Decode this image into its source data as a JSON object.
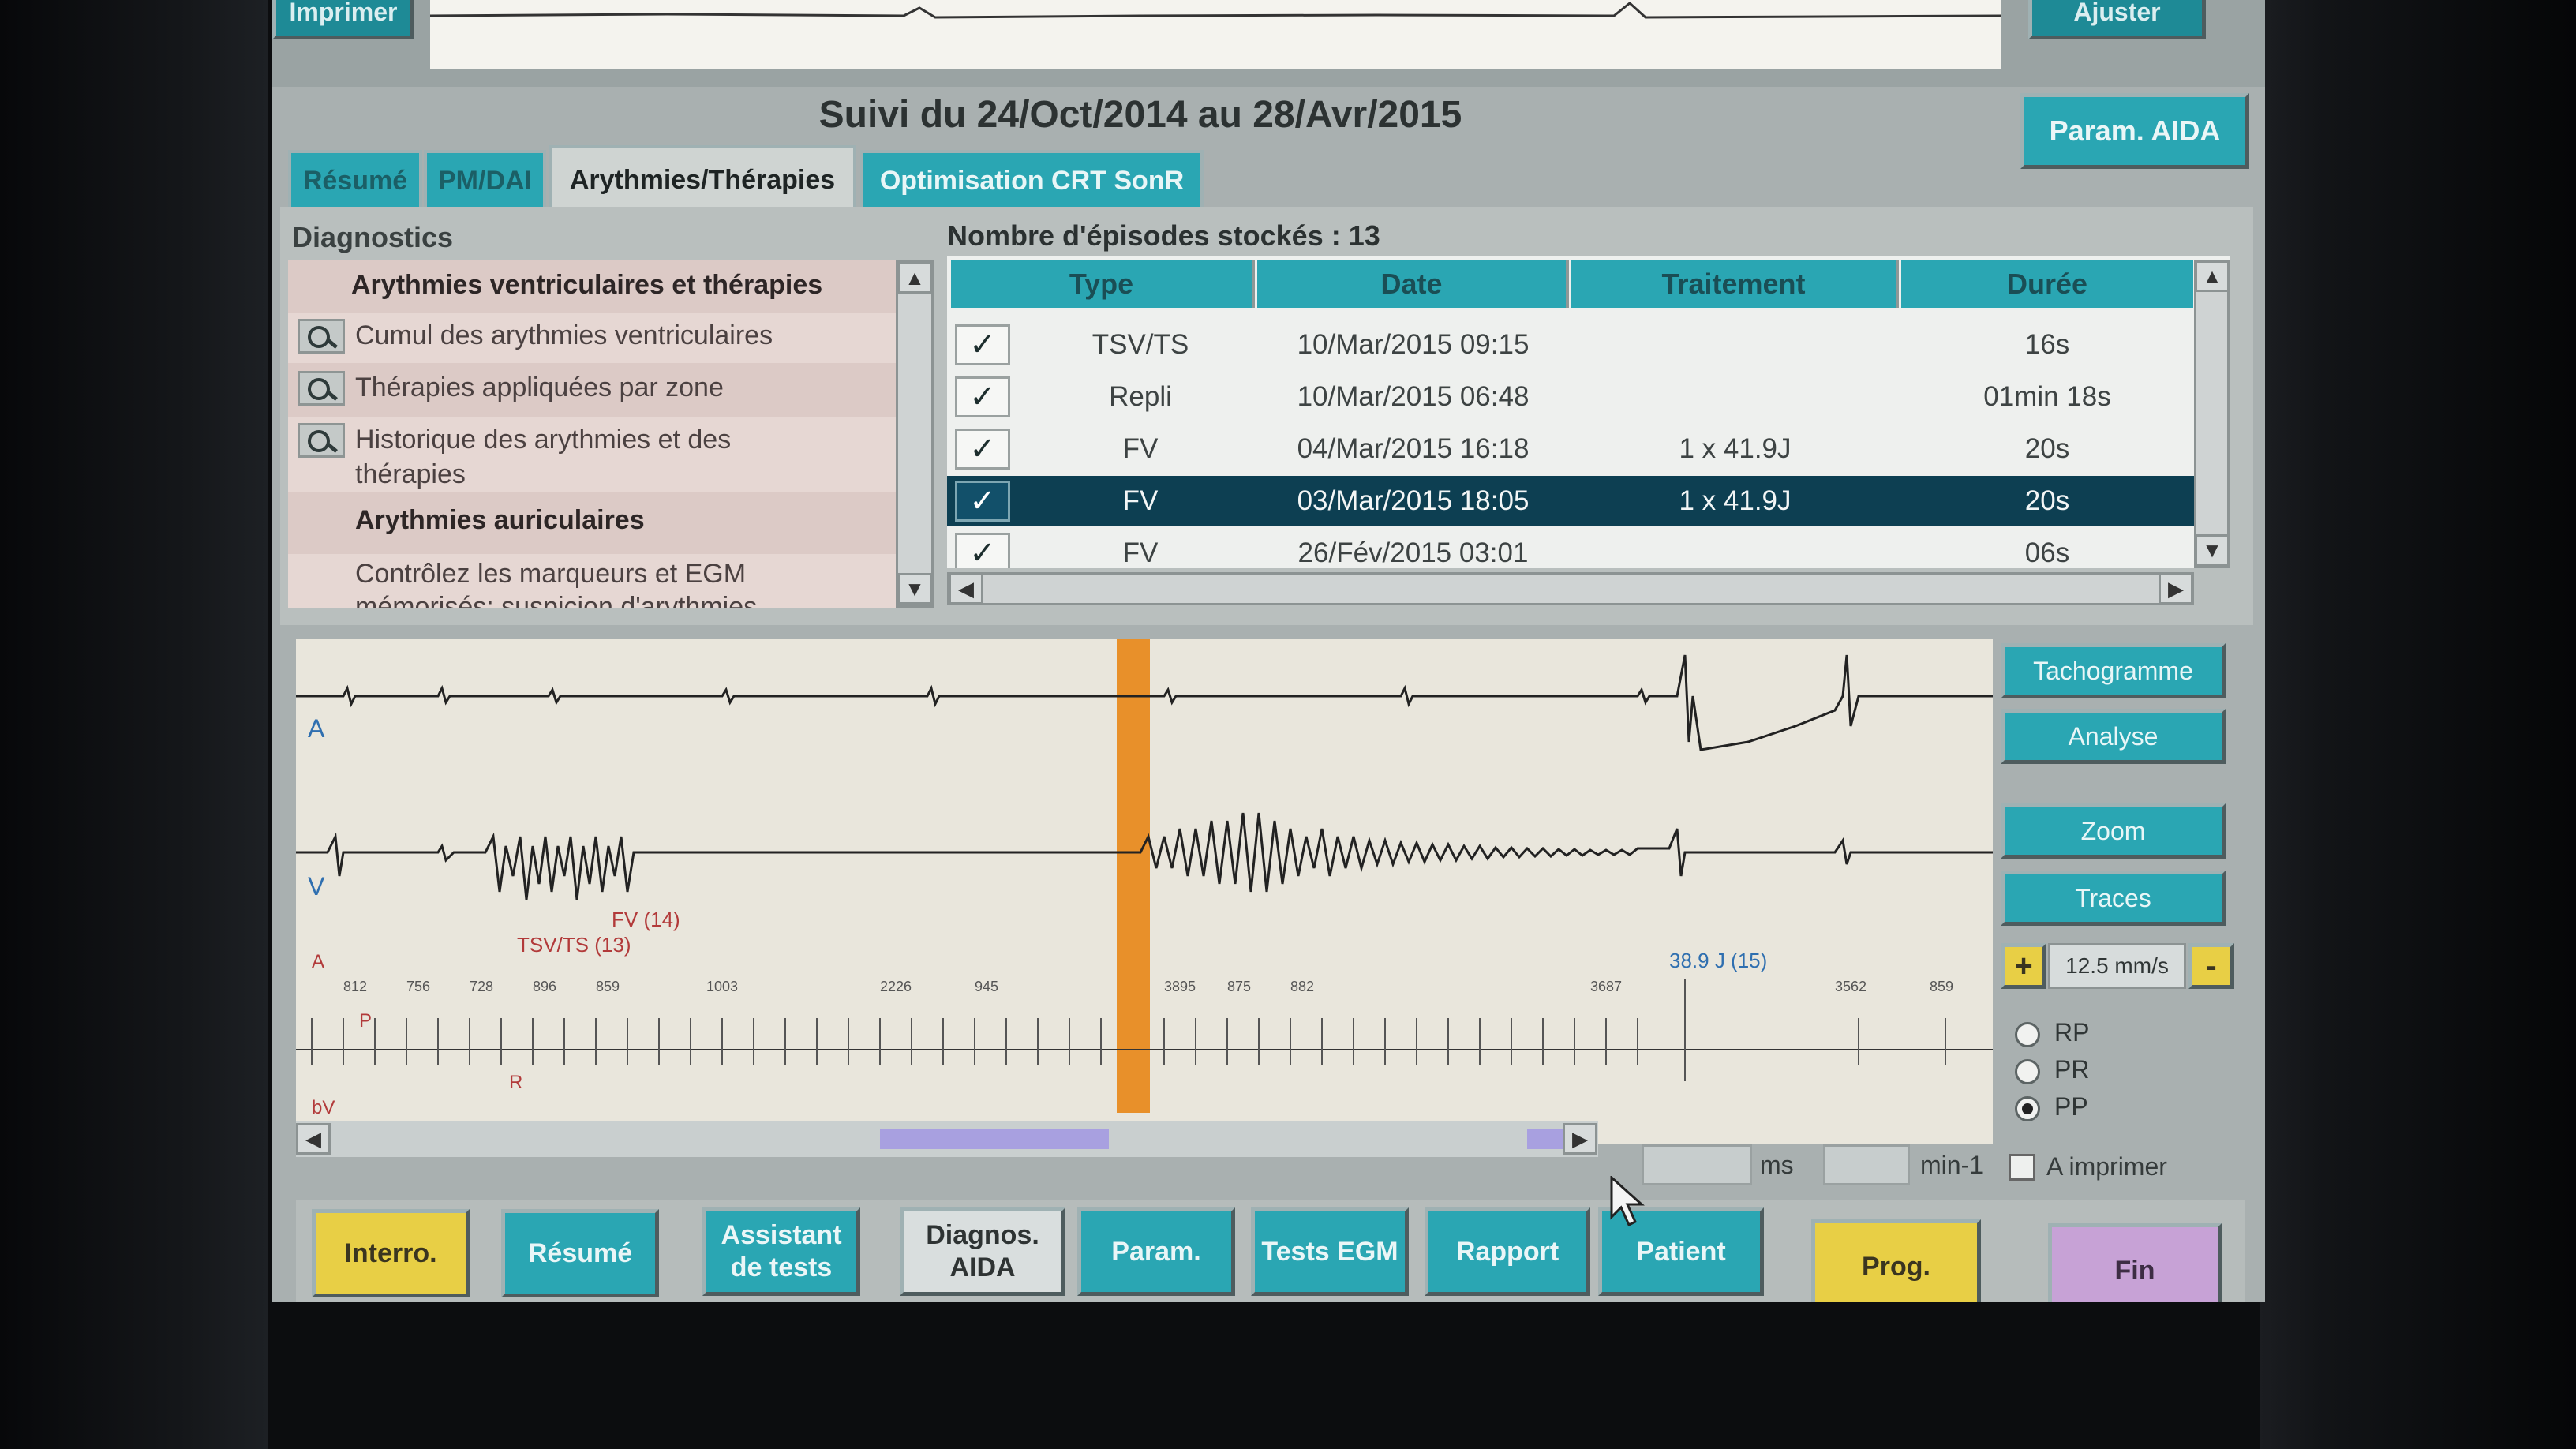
{
  "top": {
    "print_button": "Imprimer",
    "adjust_button": "Ajuster"
  },
  "title": "Suivi du 24/Oct/2014 au 28/Avr/2015",
  "param_aida_button": "Param. AIDA",
  "tabs": [
    {
      "label": "Résumé",
      "active": false
    },
    {
      "label": "PM/DAI",
      "active": false
    },
    {
      "label": "Arythmies/Thérapies",
      "active": true
    },
    {
      "label": "Optimisation CRT SonR",
      "active": false
    }
  ],
  "diagnostics": {
    "label": "Diagnostics",
    "items": [
      {
        "text": "Arythmies ventriculaires et thérapies",
        "header": true
      },
      {
        "text": "Cumul des arythmies ventriculaires",
        "icon": "magnifier-icon"
      },
      {
        "text": "Thérapies appliquées par zone",
        "icon": "magnifier-icon"
      },
      {
        "text": "Historique des arythmies et des",
        "text2": "thérapies",
        "icon": "magnifier-icon"
      },
      {
        "text": "Arythmies auriculaires",
        "header": true
      },
      {
        "text": "Contrôlez les marqueurs et EGM",
        "text2": "mémorisés: suspicion d'arythmies"
      }
    ]
  },
  "episodes": {
    "label": "Nombre d'épisodes stockés : 13",
    "columns": [
      "Type",
      "Date",
      "Traitement",
      "Durée"
    ],
    "rows": [
      {
        "type": "TSV/TS",
        "date": "10/Mar/2015 09:15",
        "treatment": "",
        "duration": "16s",
        "selected": false
      },
      {
        "type": "Repli",
        "date": "10/Mar/2015 06:48",
        "treatment": "",
        "duration": "01min 18s",
        "selected": false
      },
      {
        "type": "FV",
        "date": "04/Mar/2015 16:18",
        "treatment": "1 x 41.9J",
        "duration": "20s",
        "selected": false
      },
      {
        "type": "FV",
        "date": "03/Mar/2015 18:05",
        "treatment": "1 x 41.9J",
        "duration": "20s",
        "selected": true
      },
      {
        "type": "FV",
        "date": "26/Fév/2015 03:01",
        "treatment": "",
        "duration": "06s",
        "selected": false
      }
    ]
  },
  "ecg": {
    "channel_a": "A",
    "channel_v": "V",
    "marker_fv": "FV (14)",
    "marker_tsv": "TSV/TS (13)",
    "shock_label": "38.9 J (15)",
    "r_label": "R",
    "a_label": "A",
    "p_label": "P",
    "bv_label": "bV",
    "interval_values": [
      "812",
      "756",
      "728",
      "896",
      "859",
      "1003",
      "2226",
      "945",
      "3895",
      "875",
      "882",
      "3687",
      "3562",
      "859"
    ]
  },
  "side_buttons": [
    "Tachogramme",
    "Analyse",
    "Zoom",
    "Traces"
  ],
  "speed": {
    "plus": "+",
    "value": "12.5 mm/s",
    "minus": "-"
  },
  "radio": [
    {
      "label": "RP",
      "checked": false
    },
    {
      "label": "PR",
      "checked": false
    },
    {
      "label": "PP",
      "checked": true
    }
  ],
  "units": {
    "ms": "ms",
    "min": "min-1"
  },
  "print_checkbox": "A imprimer",
  "bottom_buttons": [
    {
      "label": "Interro.",
      "style": "yellow"
    },
    {
      "label": "Résumé",
      "style": "teal"
    },
    {
      "label": "Assistant de tests",
      "style": "teal"
    },
    {
      "label": "Diagnos. AIDA",
      "style": "pale"
    },
    {
      "label": "Param.",
      "style": "teal"
    },
    {
      "label": "Tests EGM",
      "style": "teal"
    },
    {
      "label": "Rapport",
      "style": "teal"
    },
    {
      "label": "Patient",
      "style": "teal"
    },
    {
      "label": "Prog.",
      "style": "yellow"
    },
    {
      "label": "Fin",
      "style": "violet"
    }
  ],
  "colors": {
    "accent": "#2aa6b3",
    "selected_row": "#0d3f52",
    "marker": "#e8902a",
    "annotation_red": "#b23a3a"
  }
}
